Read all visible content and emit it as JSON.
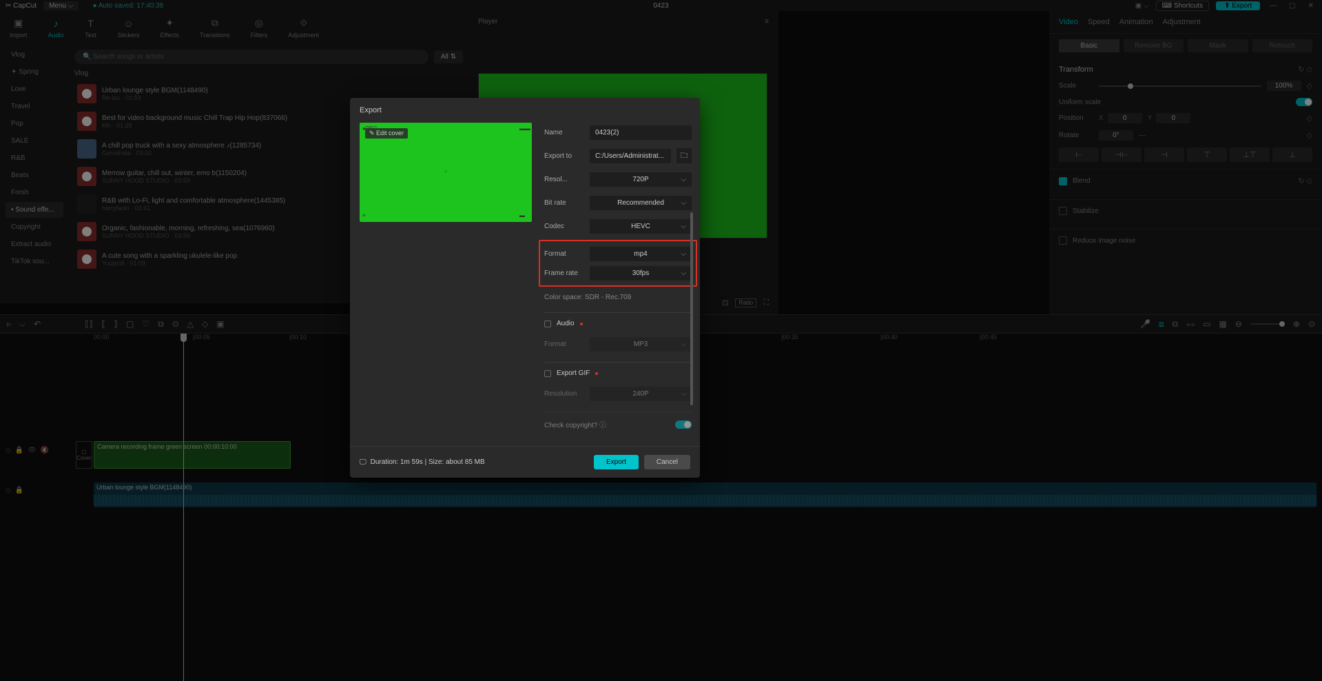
{
  "titlebar": {
    "logo": "✂ CapCut",
    "menu": "Menu ⌵",
    "autosave": "● Auto saved: 17:40:38",
    "project": "0423",
    "shortcuts": "Shortcuts",
    "export": "Export"
  },
  "mainTabs": [
    "Import",
    "Audio",
    "Text",
    "Stickers",
    "Effects",
    "Transitions",
    "Filters",
    "Adjustment"
  ],
  "mainTabIcons": [
    "▣",
    "♪",
    "T",
    "☺",
    "✦",
    "⧉",
    "◎",
    "⟐"
  ],
  "sidebar": [
    "Vlog",
    "✦ Spring",
    "Love",
    "Travel",
    "Pop",
    "SALE",
    "R&B",
    "Beats",
    "Fresh",
    "• Sound effe...",
    "Copyright",
    "Extract audio",
    "TikTok sou..."
  ],
  "search": {
    "placeholder": "🔍 Search songs or artists",
    "all": "All ⇅"
  },
  "audioCategory": "Vlog",
  "audioList": [
    {
      "title": "Urban lounge style BGM(1148490)",
      "meta": "Re-lax · 01:59",
      "thumb": "red"
    },
    {
      "title": "Best for video background music Chill Trap Hip Hop(837066)",
      "meta": "Klh · 01:28",
      "thumb": "red"
    },
    {
      "title": "A chill pop truck with a sexy atmosphere ♪(1285734)",
      "meta": "Gerushida · 03:02",
      "thumb": "blue"
    },
    {
      "title": "Merrow guitar, chill out, winter, emo b(1150204)",
      "meta": "SUNNY HOOD STUDIO · 03:59",
      "thumb": "red"
    },
    {
      "title": "R&B with Lo-Fi, light and comfortable atmosphere(1445385)",
      "meta": "harryfaoki · 03:41",
      "thumb": "dark"
    },
    {
      "title": "Organic, fashionable, morning, refreshing, sea(1076960)",
      "meta": "SUNNY HOOD STUDIO · 03:59",
      "thumb": "red"
    },
    {
      "title": "A cute song with a sparkling ukulele-like pop",
      "meta": "Yuuproll · 01:09",
      "thumb": "red"
    }
  ],
  "player": {
    "title": "Player"
  },
  "inspector": {
    "tabs": [
      "Video",
      "Speed",
      "Animation",
      "Adjustment"
    ],
    "subtabs": [
      "Basic",
      "Remove BG",
      "Mask",
      "Retouch"
    ],
    "transform": "Transform",
    "scale": {
      "label": "Scale",
      "value": "100%"
    },
    "uniform": "Uniform scale",
    "position": {
      "label": "Position",
      "x": "0",
      "y": "0"
    },
    "rotate": {
      "label": "Rotate",
      "value": "0°"
    },
    "blend": "Blend",
    "stabilize": "Stabilize",
    "noise": "Reduce image noise"
  },
  "timelineTimes": [
    "00:00",
    "|00:05",
    "|00:10",
    "|00:35",
    "|00:40",
    "|00:45"
  ],
  "coverBtn": "Cover",
  "videoClip": "Camera recording frame green screen   00:00:10:00",
  "audioClip": "Urban lounge style BGM(1148490)",
  "export": {
    "title": "Export",
    "editCover": "✎ Edit cover",
    "fields": {
      "name": {
        "label": "Name",
        "value": "0423(2)"
      },
      "exportTo": {
        "label": "Export to",
        "value": "C:/Users/Administrat..."
      },
      "resolution": {
        "label": "Resol...",
        "value": "720P"
      },
      "bitrate": {
        "label": "Bit rate",
        "value": "Recommended"
      },
      "codec": {
        "label": "Codec",
        "value": "HEVC"
      },
      "format": {
        "label": "Format",
        "value": "mp4"
      },
      "framerate": {
        "label": "Frame rate",
        "value": "30fps"
      },
      "colorspace": "Color space: SDR - Rec.709",
      "audio": "Audio",
      "audioFormat": {
        "label": "Format",
        "value": "MP3"
      },
      "gif": "Export GIF",
      "gifRes": {
        "label": "Resolution",
        "value": "240P"
      },
      "copyright": "Check copyright? ⓘ"
    },
    "footer": {
      "info": "Duration: 1m 59s | Size: about 85 MB",
      "export": "Export",
      "cancel": "Cancel"
    }
  }
}
